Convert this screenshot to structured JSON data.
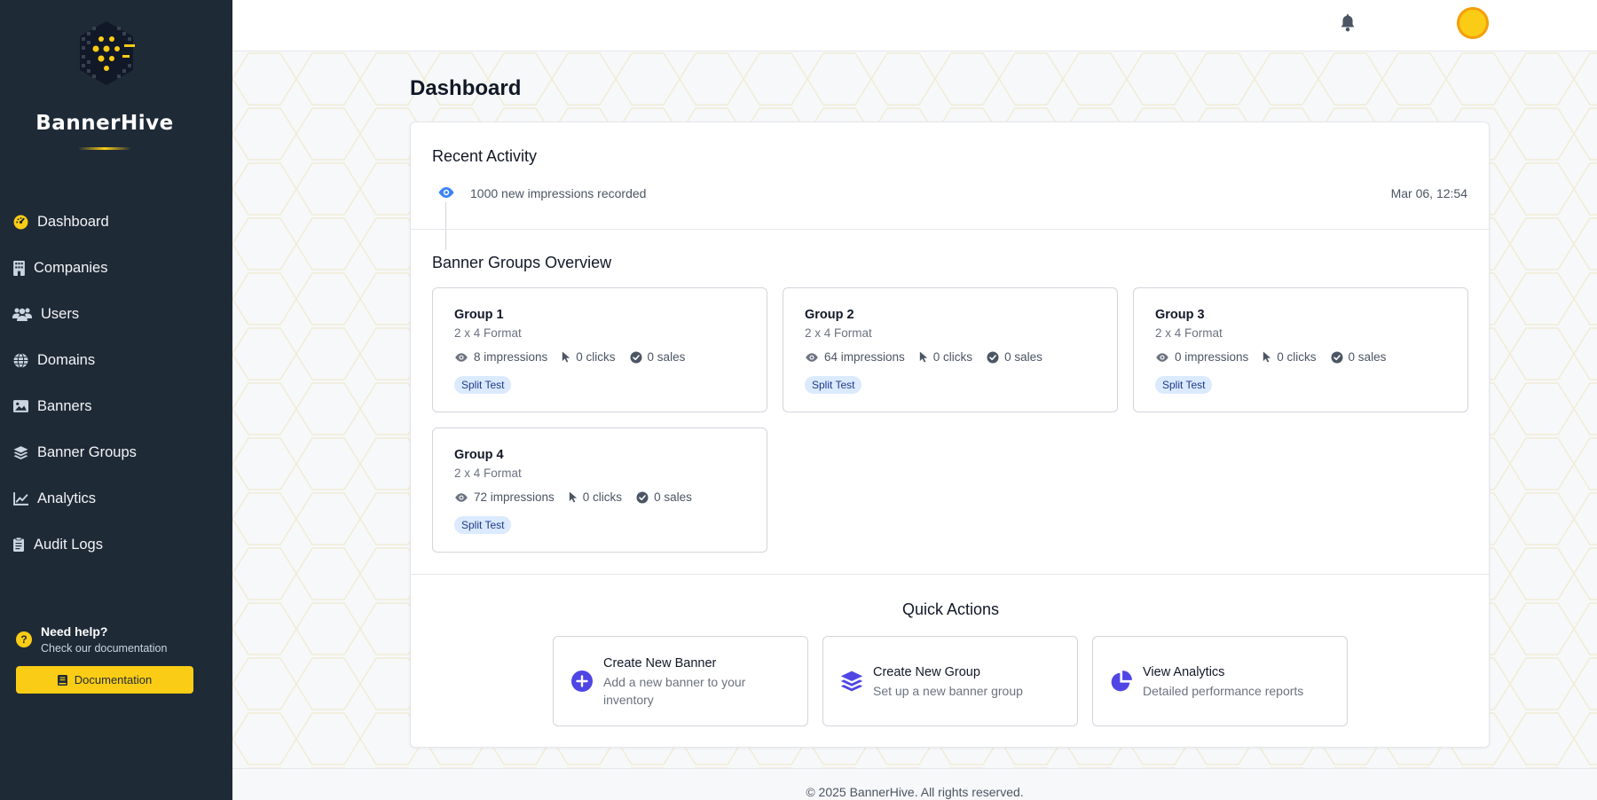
{
  "brand": {
    "name": "BannerHive"
  },
  "sidebar": {
    "items": [
      {
        "label": "Dashboard",
        "icon": "dashboard-gauge-icon"
      },
      {
        "label": "Companies",
        "icon": "building-icon"
      },
      {
        "label": "Users",
        "icon": "users-icon"
      },
      {
        "label": "Domains",
        "icon": "globe-icon"
      },
      {
        "label": "Banners",
        "icon": "image-icon"
      },
      {
        "label": "Banner Groups",
        "icon": "layers-icon"
      },
      {
        "label": "Analytics",
        "icon": "line-chart-icon"
      },
      {
        "label": "Audit Logs",
        "icon": "clipboard-icon"
      }
    ],
    "help": {
      "title": "Need help?",
      "subtitle": "Check our documentation",
      "button": "Documentation"
    }
  },
  "page": {
    "title": "Dashboard"
  },
  "recent_activity": {
    "title": "Recent Activity",
    "items": [
      {
        "text": "1000 new impressions recorded",
        "time": "Mar 06, 12:54",
        "icon": "eye-icon"
      }
    ]
  },
  "banner_groups": {
    "title": "Banner Groups Overview",
    "groups": [
      {
        "name": "Group 1",
        "format": "2 x 4 Format",
        "impressions": "8 impressions",
        "clicks": "0 clicks",
        "sales": "0 sales",
        "badge": "Split Test"
      },
      {
        "name": "Group 2",
        "format": "2 x 4 Format",
        "impressions": "64 impressions",
        "clicks": "0 clicks",
        "sales": "0 sales",
        "badge": "Split Test"
      },
      {
        "name": "Group 3",
        "format": "2 x 4 Format",
        "impressions": "0 impressions",
        "clicks": "0 clicks",
        "sales": "0 sales",
        "badge": "Split Test"
      },
      {
        "name": "Group 4",
        "format": "2 x 4 Format",
        "impressions": "72 impressions",
        "clicks": "0 clicks",
        "sales": "0 sales",
        "badge": "Split Test"
      }
    ]
  },
  "quick_actions": {
    "title": "Quick Actions",
    "items": [
      {
        "title": "Create New Banner",
        "subtitle": "Add a new banner to your inventory",
        "icon": "plus-circle-icon"
      },
      {
        "title": "Create New Group",
        "subtitle": "Set up a new banner group",
        "icon": "layers-icon"
      },
      {
        "title": "View Analytics",
        "subtitle": "Detailed performance reports",
        "icon": "pie-chart-icon"
      }
    ]
  },
  "footer": {
    "text": "© 2025 BannerHive. All rights reserved."
  },
  "colors": {
    "sidebar": "#1f2a37",
    "accent": "#facc15",
    "primary": "#4f46e5",
    "badge_bg": "#dbeafe"
  }
}
